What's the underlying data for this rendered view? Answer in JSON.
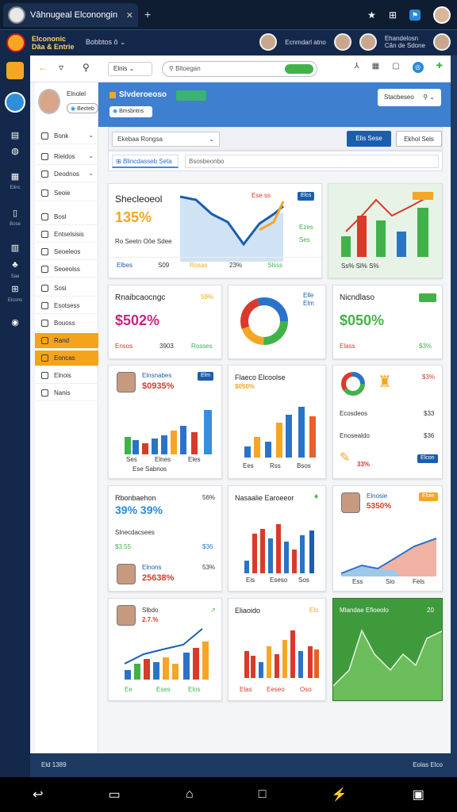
{
  "browser": {
    "tab_title": "Vâhnugeal Elconongin",
    "close_glyph": "✕",
    "new_tab_glyph": "+",
    "icons": [
      "star-icon",
      "bookmark-icon",
      "extension-icon",
      "profile-avatar"
    ]
  },
  "account": {
    "brand_line1": "Elcononic",
    "brand_line2": "Dâa & Entrie",
    "workspace": "Bobbtos ô",
    "user1_name": "Ecnmdarl atno",
    "user2_name_line1": "Ehandelosn",
    "user2_name_line2": "Cân de Sdone"
  },
  "rail": {
    "labels": [
      "Eiinc",
      "Bose",
      "Sae",
      "Elcons",
      "Slore",
      "Buon",
      "Solts"
    ]
  },
  "toolbar": {
    "back_glyph": "←",
    "view_glyph": "▿",
    "select_value": "Elnis",
    "search_placeholder": "Bltoegan"
  },
  "sidebar": {
    "profile_name": "Elnolel",
    "profile_button": "Becteb",
    "items": [
      {
        "label": "Bonk",
        "chev": "⌄"
      },
      {
        "label": "Rieldos",
        "chev": "⌄"
      },
      {
        "label": "Deodnos",
        "chev": "⌄"
      },
      {
        "label": "Seoie",
        "chev": ""
      },
      {
        "label": "Bosl",
        "chev": ""
      },
      {
        "label": "Entselsisis",
        "chev": ""
      },
      {
        "label": "Seoeleos",
        "chev": ""
      },
      {
        "label": "Seoeolss",
        "chev": ""
      },
      {
        "label": "Sosi",
        "chev": ""
      },
      {
        "label": "Esotsess",
        "chev": ""
      },
      {
        "label": "Bouoss",
        "chev": ""
      },
      {
        "label": "Rand",
        "chev": ""
      },
      {
        "label": "Eoncas",
        "chev": ""
      },
      {
        "label": "Elnois",
        "chev": ""
      },
      {
        "label": "Nanis",
        "chev": ""
      }
    ]
  },
  "hero": {
    "title": "Slvderoeoso",
    "button": "Bmsbntns",
    "select_value": "Stacbeseo"
  },
  "subbar": {
    "tab_select": "Ekebaa  Rongsa",
    "primary_button": "Elis Sese",
    "secondary_button": "Ekhol Sels"
  },
  "filter": {
    "chip": "Blincdasseb Seta",
    "input": "Bsosbeonbo"
  },
  "cards": {
    "c1": {
      "title": "Shecleoeol",
      "big": "135%",
      "sub": "Ro Seetn Oôe Sdee",
      "foot": [
        "Elbes",
        "S09",
        "Rosas",
        "23%",
        "Slsss"
      ],
      "badge": "Elcs",
      "vals": [
        "Ese ss",
        "Ezes",
        "Ses"
      ]
    },
    "c3": {
      "title": "Rnaibcaocngc",
      "big": "$502%",
      "pct": "59%",
      "foot": [
        "Ensos",
        "3903",
        "Rosses"
      ]
    },
    "c4": {
      "badge1": "Elle",
      "badge2": "Elm"
    },
    "c5": {
      "title": "Nicndlaso",
      "big": "$050%",
      "foot": [
        "Elass",
        "$3%"
      ]
    },
    "c6": {
      "name": "Elnsnabes",
      "big": "$0935%",
      "badge": "Elm",
      "axis": [
        "Ses",
        "Elnes",
        "Eles"
      ],
      "foot": "Ese Sabnos"
    },
    "c7": {
      "title": "Flaeco Elcoolse",
      "big": "$050%",
      "axis": [
        "Ees",
        "Rss",
        "Bsos"
      ]
    },
    "c8": {
      "row1": "Ecosdeos",
      "row1v": "$33",
      "row2": "Enosealdo",
      "row2v": "$36",
      "big": "33%",
      "badge": "Elcon"
    },
    "c9": {
      "title": "Rbonbaehon",
      "pct": "56%",
      "big": "39% 39%",
      "row": "Slnecdacsees",
      "row_v1": "$3.55",
      "row_v2": "$36",
      "name": "Elnons",
      "big2": "25638%",
      "pct2": "53%"
    },
    "c10": {
      "title": "Nasaalie Earoeeor",
      "axis": [
        "Eis",
        "Eseso",
        "Sos"
      ]
    },
    "c11": {
      "name": "Elnosie",
      "badge": "Eloie",
      "big": "5350%",
      "axis": [
        "Ess",
        "Sio",
        "Fels"
      ]
    },
    "c12": {
      "title": "Slbdo",
      "big": "2.7.%",
      "axis": [
        "Ee",
        "Eses",
        "Elos"
      ]
    },
    "c13": {
      "title": "Eliaoido",
      "badge": "Elo",
      "foot": [
        "Elas",
        "Eeseo",
        "Oso"
      ]
    },
    "c14": {
      "title": "Mlandae Efioeolo",
      "val": "20"
    }
  },
  "colors": {
    "accent": "#f5a623",
    "primary": "#1a5eae",
    "green": "#41b24a",
    "red": "#d93a2b",
    "blue": "#2a73c8"
  },
  "status": {
    "left": "Eld 1389",
    "right": "Eolas Elco"
  },
  "navbar": {
    "icons": [
      "back-icon",
      "recents-icon",
      "home-icon",
      "overview-icon",
      "assistant-icon",
      "tabs-icon"
    ]
  }
}
